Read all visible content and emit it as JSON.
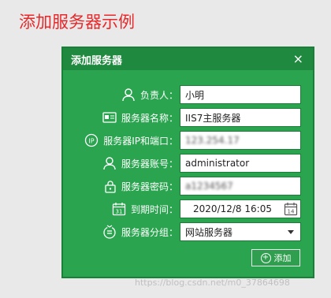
{
  "page_title": "添加服务器示例",
  "dialog": {
    "title": "添加服务器",
    "close": "×"
  },
  "fields": {
    "owner": {
      "label": "负责人：",
      "value": "小明",
      "icon": "person-icon"
    },
    "name": {
      "label": "服务器名称：",
      "value": "IIS7主服务器",
      "icon": "server-card-icon"
    },
    "ip_port": {
      "label": "服务器IP和端口：",
      "value": "123.254.17",
      "icon": "ip-icon"
    },
    "account": {
      "label": "服务器账号：",
      "value": "administrator",
      "icon": "user-icon"
    },
    "password": {
      "label": "服务器密码：",
      "value": "a1234567",
      "icon": "lock-icon"
    },
    "expiry": {
      "label": "到期时间：",
      "value": "2020/12/8 16:05",
      "icon": "calendar-icon",
      "calendar_day": "14"
    },
    "group": {
      "label": "服务器分组：",
      "value": "网站服务器",
      "icon": "group-icon"
    }
  },
  "actions": {
    "add_label": "添加",
    "add_icon": "plus-circle-icon"
  },
  "watermark": "https://blog.csdn.net/m0_37864698",
  "colors": {
    "dialog_bg": "#2aa44f",
    "header_bg": "#1f8a3f",
    "title_red": "#e8282a"
  }
}
